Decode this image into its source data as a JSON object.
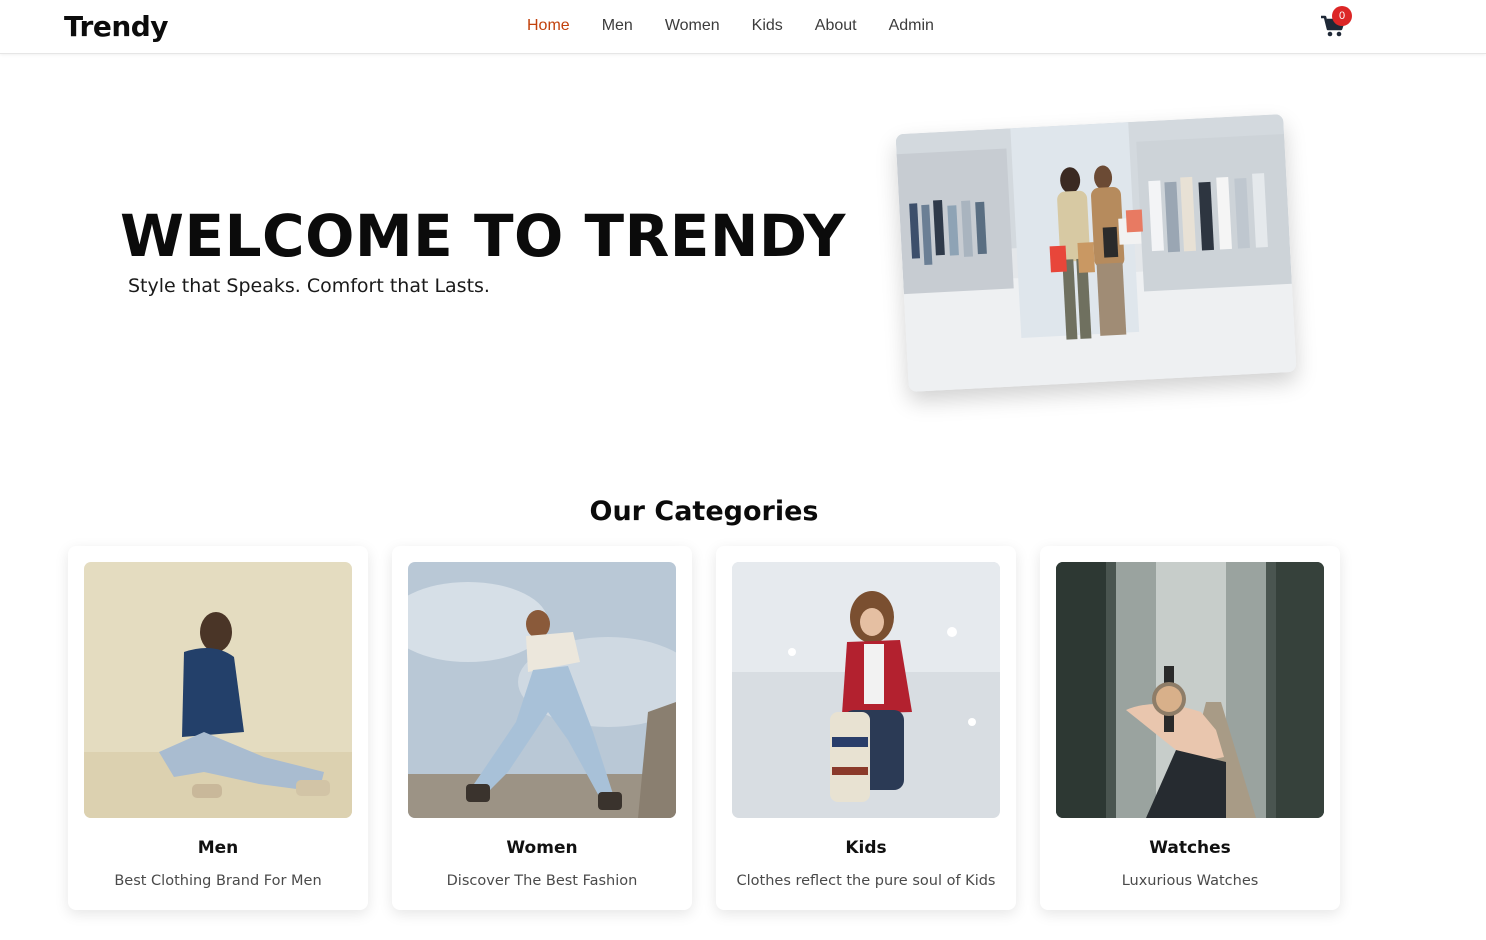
{
  "header": {
    "brand": "Trendy",
    "nav": [
      {
        "label": "Home",
        "active": true
      },
      {
        "label": "Men"
      },
      {
        "label": "Women"
      },
      {
        "label": "Kids"
      },
      {
        "label": "About"
      },
      {
        "label": "Admin"
      }
    ],
    "cart_count": "0",
    "cart_icon": "shopping-cart-icon",
    "accent_color": "#c2410c",
    "badge_color": "#dc2626"
  },
  "hero": {
    "title": "WELCOME TO TRENDY",
    "subtitle": "Style that Speaks. Comfort that Lasts."
  },
  "categories": {
    "heading": "Our Categories",
    "items": [
      {
        "title": "Men",
        "description": "Best Clothing Brand For Men"
      },
      {
        "title": "Women",
        "description": "Discover The Best Fashion"
      },
      {
        "title": "Kids",
        "description": "Clothes reflect the pure soul of Kids"
      },
      {
        "title": "Watches",
        "description": "Luxurious Watches"
      }
    ]
  }
}
